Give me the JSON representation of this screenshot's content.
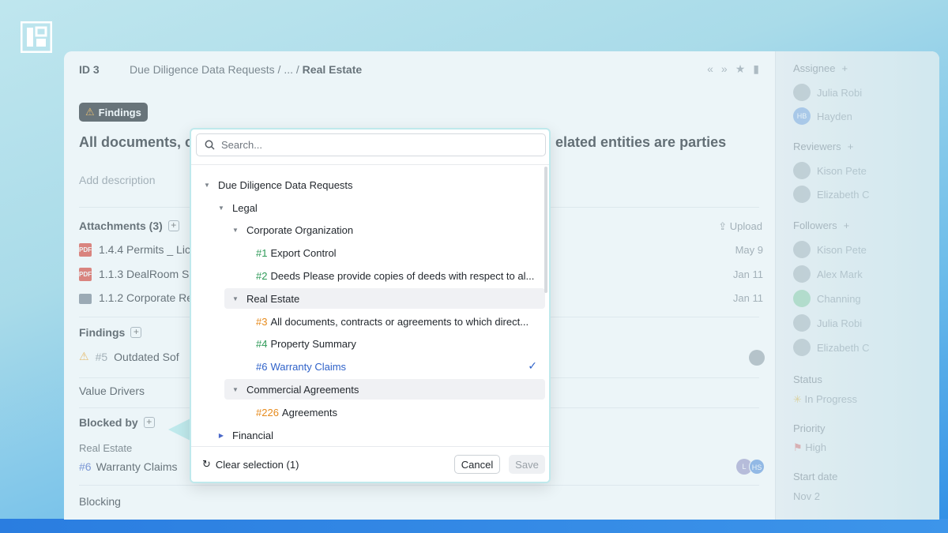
{
  "header": {
    "id_label": "ID 3",
    "breadcrumb": "Due Diligence Data Requests / ... / ",
    "breadcrumb_current": "Real Estate"
  },
  "badge": {
    "label": "Findings"
  },
  "title_left": "All documents, c",
  "title_right": "elated entities are parties",
  "add_description": "Add description",
  "attachments": {
    "heading": "Attachments (3)",
    "upload": "Upload",
    "items": [
      {
        "name": "1.4.4 Permits _ Lic",
        "date": "May 9",
        "type": "pdf"
      },
      {
        "name": "1.1.3 DealRoom Se",
        "date": "Jan 11",
        "type": "pdf"
      },
      {
        "name": "1.1.2 Corporate Re",
        "date": "Jan 11",
        "type": "folder"
      }
    ]
  },
  "findings": {
    "heading": "Findings",
    "item_num": "#5",
    "item_label": "Outdated Sof"
  },
  "value_drivers": "Value Drivers",
  "blocked_by": {
    "heading": "Blocked by",
    "group": "Real Estate",
    "item_num": "#6",
    "item_label": "Warranty Claims",
    "avatar_initials_1": "L",
    "avatar_initials_2": "HS"
  },
  "blocking": "Blocking",
  "right_panel": {
    "assignee_label": "Assignee",
    "assignees": [
      {
        "name": "Julia Robi",
        "initials": ""
      },
      {
        "name": "Hayden",
        "initials": "HB"
      }
    ],
    "reviewers_label": "Reviewers",
    "reviewers": [
      {
        "name": "Kison Pete",
        "initials": ""
      },
      {
        "name": "Elizabeth C",
        "initials": ""
      }
    ],
    "followers_label": "Followers",
    "followers": [
      {
        "name": "Kison Pete",
        "initials": ""
      },
      {
        "name": "Alex Mark",
        "initials": ""
      },
      {
        "name": "Channing",
        "initials": ""
      },
      {
        "name": "Julia Robi",
        "initials": ""
      },
      {
        "name": "Elizabeth C",
        "initials": ""
      }
    ],
    "status_label": "Status",
    "status_value": "In Progress",
    "priority_label": "Priority",
    "priority_value": "High",
    "start_date_label": "Start date",
    "start_date_value": "Nov 2"
  },
  "popup": {
    "search_placeholder": "Search...",
    "tree": [
      {
        "label": "Due Diligence Data Requests",
        "num": "",
        "level": 0,
        "caret": "down"
      },
      {
        "label": "Legal",
        "num": "",
        "level": 1,
        "caret": "down"
      },
      {
        "label": "Corporate Organization",
        "num": "",
        "level": 2,
        "caret": "down"
      },
      {
        "label": "Export Control",
        "num": "#1",
        "num_color": "green",
        "level": 3
      },
      {
        "label": "Deeds Please provide copies of deeds with respect to al...",
        "num": "#2",
        "num_color": "green",
        "level": 3
      },
      {
        "label": "Real Estate",
        "num": "",
        "level": 2,
        "caret": "down",
        "highlight": true
      },
      {
        "label": "All documents, contracts or agreements to which direct...",
        "num": "#3",
        "num_color": "orange",
        "level": 3
      },
      {
        "label": "Property Summary",
        "num": "#4",
        "num_color": "green",
        "level": 3
      },
      {
        "label": "Warranty Claims",
        "num": "#6",
        "num_color": "blue",
        "level": 3,
        "checked": true
      },
      {
        "label": "Commercial Agreements",
        "num": "",
        "level": 2,
        "caret": "down",
        "highlight": true
      },
      {
        "label": "Agreements",
        "num": "#226",
        "num_color": "orange",
        "level": 3
      },
      {
        "label": "Financial",
        "num": "",
        "level": 1,
        "caret": "right"
      }
    ],
    "clear_selection": "Clear selection (1)",
    "cancel": "Cancel",
    "save": "Save"
  },
  "colors": {
    "accent_blue": "#2f62c9",
    "green_num": "#2e9a58",
    "orange_num": "#e68a1c",
    "badge_bg": "#2b2f35",
    "popup_border": "#bfe9ec"
  }
}
